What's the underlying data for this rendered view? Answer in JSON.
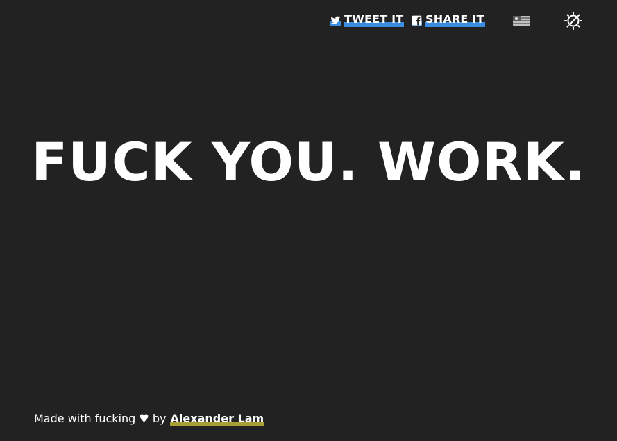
{
  "header": {
    "tweet_label": "TWEET IT",
    "share_label": "SHARE IT",
    "tweet_icon": "twitter-icon",
    "share_icon": "facebook-icon",
    "flag_icon": "us-flag-icon",
    "theme_icon": "theme-toggle-icon",
    "accent_color": "#3a8de0"
  },
  "main": {
    "headline": "FUCK YOU. WORK."
  },
  "footer": {
    "made_with": "Made with fucking ♥ by",
    "author": "Alexander Lam",
    "author_underline_color": "#a8a032"
  },
  "colors": {
    "background": "#222222",
    "text": "#ffffff"
  }
}
